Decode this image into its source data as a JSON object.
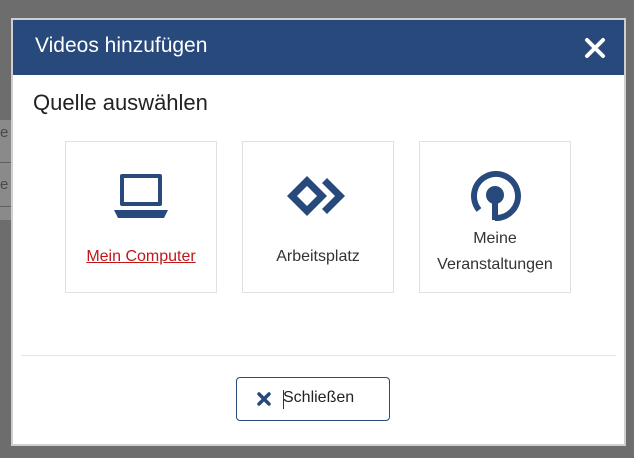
{
  "background": {
    "letters": [
      "e",
      "e"
    ]
  },
  "dialog": {
    "title": "Videos hinzufügen",
    "close_icon": "close-icon",
    "heading": "Quelle auswählen",
    "sources": [
      {
        "label": "Mein Computer",
        "icon": "laptop-icon",
        "link": true
      },
      {
        "label": "Arbeitsplatz",
        "icon": "arbeitsplatz-icon",
        "link": false
      },
      {
        "label_lines": [
          "Meine",
          "Veranstaltungen"
        ],
        "icon": "veranstaltungen-icon",
        "link": false
      }
    ],
    "close_button": {
      "label": "Schließen",
      "icon": "close-icon"
    }
  },
  "colors": {
    "primary": "#28497c",
    "link": "#c0171b"
  }
}
